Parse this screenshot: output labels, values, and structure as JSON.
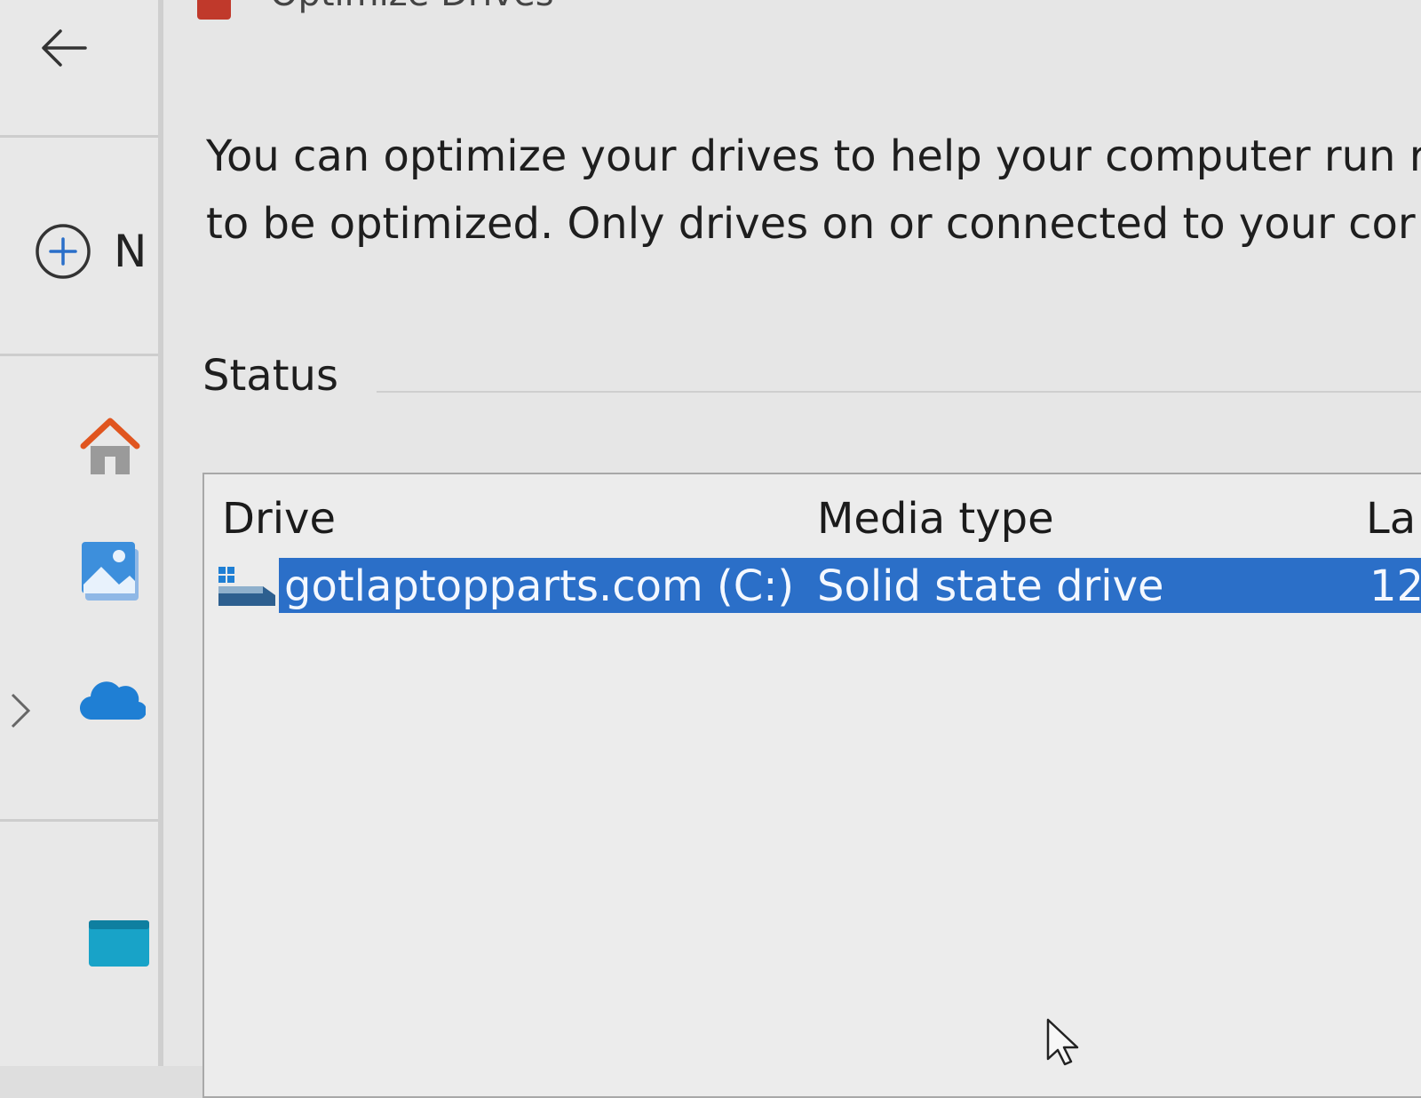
{
  "sidebar": {
    "new_label": "N",
    "icons": [
      "back-arrow-icon",
      "plus-circle-icon",
      "home-icon",
      "gallery-icon",
      "onedrive-cloud-icon",
      "chevron-right-icon",
      "desktop-icon"
    ]
  },
  "dialog": {
    "title": "Optimize Drives",
    "description_line1": "You can optimize your drives to help your computer run r",
    "description_line2": "to be optimized. Only drives on or connected to your cor",
    "status_label": "Status",
    "columns": {
      "drive": "Drive",
      "media_type": "Media type",
      "last": "La"
    },
    "rows": [
      {
        "drive": "gotlaptopparts.com (C:)",
        "media_type": "Solid state drive",
        "last": "12",
        "selected": true
      }
    ]
  },
  "colors": {
    "selection": "#2b6fc8",
    "home_accent": "#e0551f",
    "onedrive": "#1f7fd4"
  }
}
